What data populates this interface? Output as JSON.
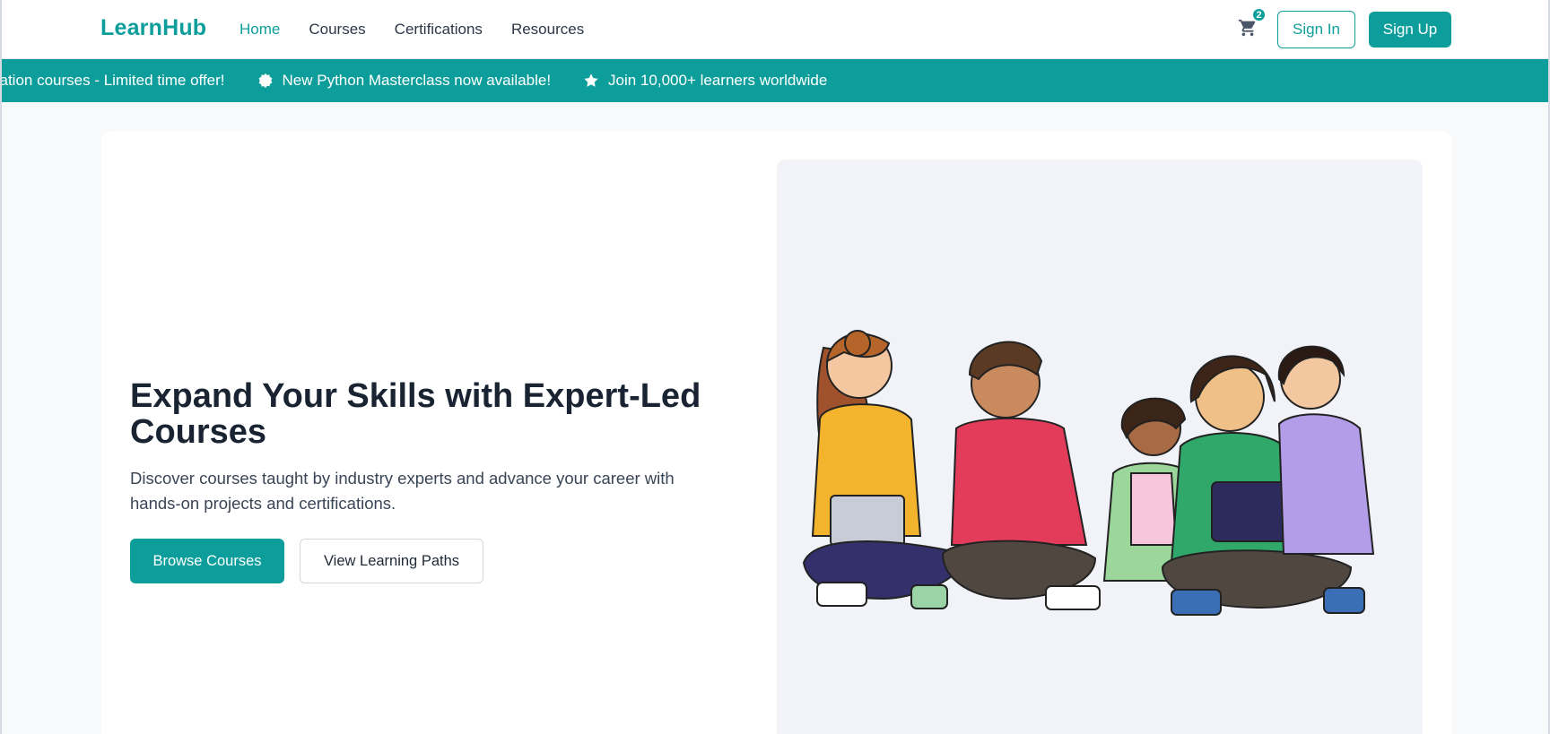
{
  "header": {
    "logo": "LearnHub",
    "nav": [
      {
        "label": "Home",
        "active": true
      },
      {
        "label": "Courses",
        "active": false
      },
      {
        "label": "Certifications",
        "active": false
      },
      {
        "label": "Resources",
        "active": false
      }
    ],
    "cart_count": "2",
    "cart_icon": "shopping-cart-icon",
    "sign_in": "Sign In",
    "sign_up": "Sign Up"
  },
  "announcements": [
    {
      "text": "tification courses - Limited time offer!",
      "icon": ""
    },
    {
      "text": "New Python Masterclass now available!",
      "icon": "badge-icon"
    },
    {
      "text": "Join 10,000+ learners worldwide",
      "icon": "star-icon"
    }
  ],
  "hero": {
    "title": "Expand Your Skills with Expert-Led Courses",
    "subtitle": "Discover courses taught by industry experts and advance your career with hands-on projects and certifications.",
    "primary_button": "Browse Courses",
    "secondary_button": "View Learning Paths",
    "illustration": "group-of-learners-illustration"
  },
  "colors": {
    "brand": "#0d9e9b",
    "text_dark": "#1a2332",
    "background": "#f8f9fb"
  }
}
